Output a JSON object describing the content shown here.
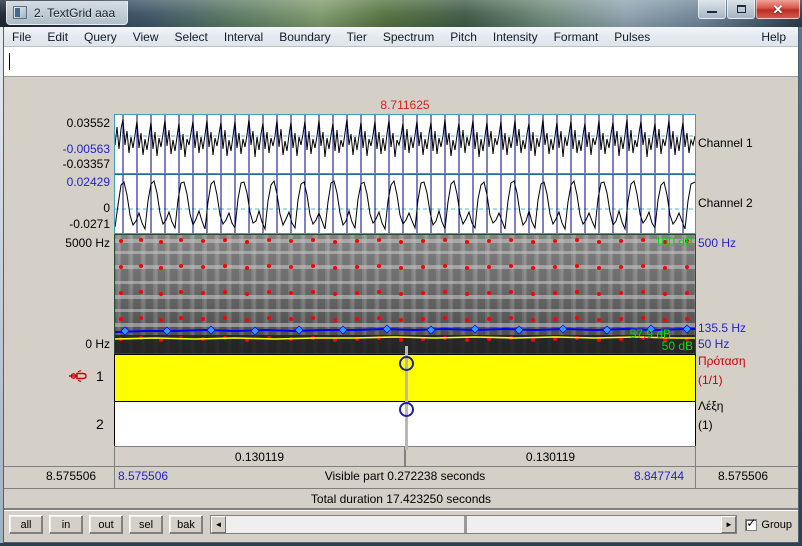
{
  "window": {
    "title": "2. TextGrid aaa",
    "icon": "textgrid-icon",
    "minimize_label": "–",
    "maximize_label": "□",
    "close_label": "✕"
  },
  "menubar": {
    "items": [
      {
        "label": "File"
      },
      {
        "label": "Edit"
      },
      {
        "label": "Query"
      },
      {
        "label": "View"
      },
      {
        "label": "Select"
      },
      {
        "label": "Interval"
      },
      {
        "label": "Boundary"
      },
      {
        "label": "Tier"
      },
      {
        "label": "Spectrum"
      },
      {
        "label": "Pitch"
      },
      {
        "label": "Intensity"
      },
      {
        "label": "Formant"
      },
      {
        "label": "Pulses"
      }
    ],
    "help": "Help"
  },
  "text_entry": {
    "value": "",
    "placeholder": ""
  },
  "cursor": {
    "time_label": "8.711625"
  },
  "channel1": {
    "label": "Channel 1",
    "max": "0.03552",
    "cursor_value": "-0.00563",
    "min": "-0.03357"
  },
  "channel2": {
    "label": "Channel 2",
    "max": "0.02429",
    "zero": "0",
    "min": "-0.0271"
  },
  "spectrogram": {
    "top_freq": "5000 Hz",
    "bottom_freq": "0 Hz",
    "max_db": "100 dB",
    "min_db": "50 dB",
    "cursor_db": "57.9 dB",
    "pitch_max": "500 Hz",
    "pitch_min": "50 Hz",
    "pitch_cursor": "135.5 Hz"
  },
  "tiers": [
    {
      "number": "1",
      "name": "Πρόταση",
      "count": "(1/1)",
      "selected": true,
      "interval_text": ""
    },
    {
      "number": "2",
      "name": "Λέξη",
      "count": "(1)",
      "selected": false,
      "interval_text": ""
    }
  ],
  "selection": {
    "left_duration": "0.130119",
    "right_duration": "0.130119",
    "start_outer": "8.575506",
    "start_inner": "8.575506",
    "visible_part": "Visible part 0.272238 seconds",
    "end_inner": "8.847744",
    "end_outer": "8.575506",
    "total_duration": "Total duration 17.423250 seconds"
  },
  "bottom_controls": {
    "buttons": [
      {
        "label": "all"
      },
      {
        "label": "in"
      },
      {
        "label": "out"
      },
      {
        "label": "sel"
      },
      {
        "label": "bak"
      }
    ],
    "scroll_left": "◄",
    "scroll_right": "►",
    "group_label": "Group",
    "group_checked": true
  },
  "colors": {
    "cursor_red": "#d02020",
    "pitch_blue": "#0000ff",
    "intensity_yellow": "#ffff00",
    "formant_red": "#ff0000",
    "tier_selected_bg": "#ffff00",
    "value_blue": "#2222cc",
    "db_green": "#00cc00"
  }
}
